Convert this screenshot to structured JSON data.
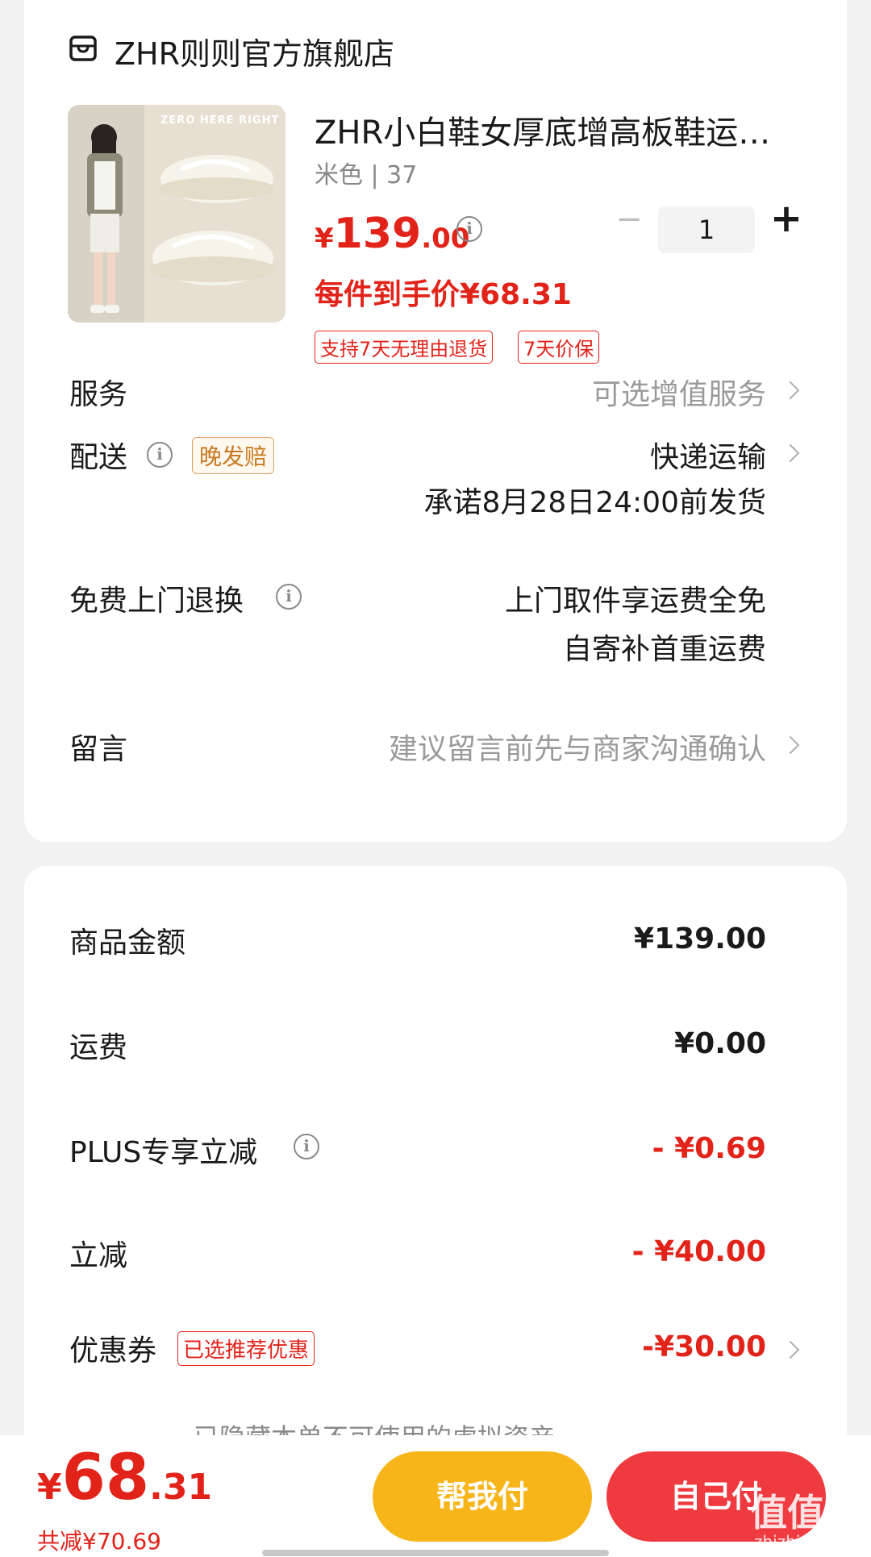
{
  "store": {
    "name": "ZHR则则官方旗舰店",
    "icon": "store-icon"
  },
  "product": {
    "title": "ZHR小白鞋女厚底增高板鞋运动…",
    "sku": "米色 | 37",
    "price_symbol": "¥",
    "price_int": "139",
    "price_dec": ".00",
    "quantity": "1",
    "qty_minus": "−",
    "qty_plus": "+",
    "price_per_item": "每件到手价¥68.31",
    "tags": [
      "支持7天无理由退货",
      "7天价保"
    ],
    "image_text": "ZERO HERE RIGHT"
  },
  "rows": {
    "service_label": "服务",
    "service_value": "可选增值服务",
    "delivery_label": "配送",
    "delivery_tag": "晚发赔",
    "delivery_value": "快递运输",
    "delivery_promise": "承诺8月28日24:00前发货",
    "return_label": "免费上门退换",
    "return_value_1": "上门取件享运费全免",
    "return_value_2": "自寄补首重运费",
    "message_label": "留言",
    "message_placeholder": "建议留言前先与商家沟通确认"
  },
  "summary": {
    "goods_label": "商品金额",
    "goods_value": "¥139.00",
    "shipping_label": "运费",
    "shipping_value": "¥0.00",
    "plus_label": "PLUS专享立减",
    "plus_value": "- ¥0.69",
    "discount_label": "立减",
    "discount_value": "- ¥40.00",
    "coupon_label": "优惠券",
    "coupon_tag": "已选推荐优惠",
    "coupon_value": "-¥30.00",
    "hidden_note": "已隐藏本单不可使用的虚拟资产"
  },
  "bottom": {
    "total_symbol": "¥",
    "total_int": "68",
    "total_dec": ".31",
    "total_saved": "共减¥70.69",
    "help_pay": "帮我付",
    "self_pay": "自己付"
  },
  "watermark": {
    "main": "值值值",
    "sub": "zhizhizhi.com"
  },
  "colors": {
    "accent_red": "#e2231a",
    "button_yellow": "#f7b51a",
    "button_red": "#ef3a3f"
  }
}
